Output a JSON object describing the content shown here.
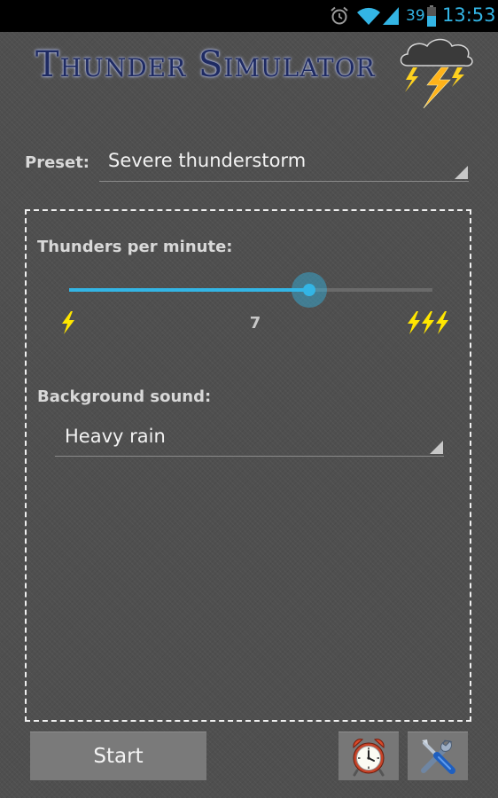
{
  "status_bar": {
    "battery_level": "39",
    "time": "13:53",
    "icons": [
      "alarm-clock-icon",
      "wifi-icon",
      "cell-signal-icon",
      "battery-icon"
    ],
    "accent_color": "#33b5e5"
  },
  "header": {
    "title": "Thunder Simulator",
    "logo": "storm-cloud-lightning-icon"
  },
  "preset": {
    "label": "Preset:",
    "selected": "Severe thunderstorm"
  },
  "settings": {
    "thunders_label": "Thunders per minute:",
    "thunders_value": "7",
    "slider_fraction": 0.66,
    "min_icon": "single-bolt-icon",
    "max_icon": "triple-bolt-icon",
    "background_label": "Background sound:",
    "background_selected": "Heavy rain"
  },
  "bottom_bar": {
    "start_label": "Start",
    "alarm_icon": "alarm-clock-icon",
    "tools_icon": "tools-icon"
  },
  "colors": {
    "accent": "#33b5e5",
    "bolt": "#ffe600",
    "title": "#1f2b63",
    "background": "#4f4f4f"
  }
}
